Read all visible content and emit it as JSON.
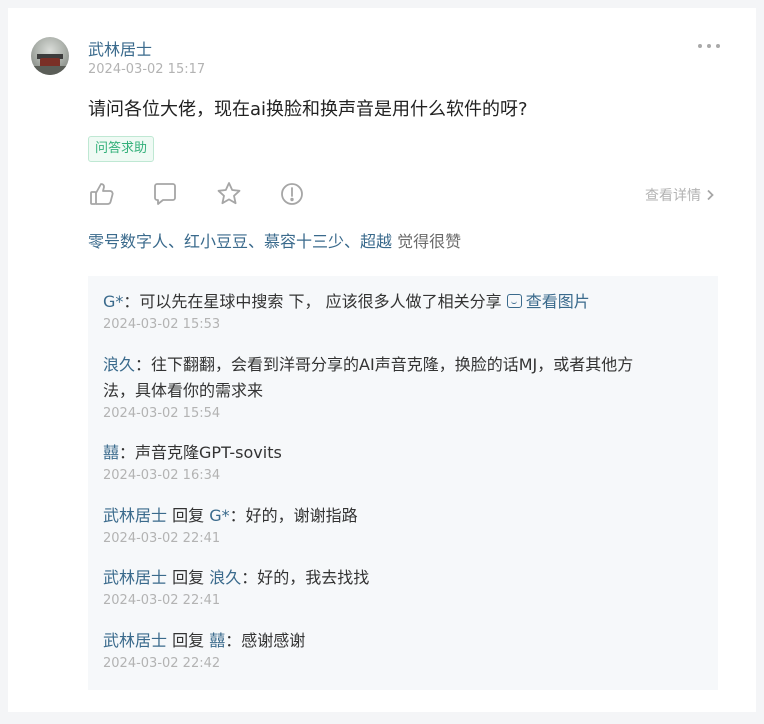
{
  "post": {
    "author": "武林居士",
    "time": "2024-03-02 15:17",
    "text": "请问各位大佬，现在ai换脸和换声音是用什么软件的呀?",
    "tag": "问答求助",
    "view_details": "查看详情",
    "likers": "零号数字人、红小豆豆、慕容十三少、超越",
    "likers_suffix": " 觉得很赞"
  },
  "icons": [
    "thumbs-up-icon",
    "comment-icon",
    "star-icon",
    "alert-icon",
    "more-icon",
    "chevron-right-icon",
    "image-icon"
  ],
  "comments": [
    {
      "name": "G*",
      "sep": "：",
      "text": "可以先在星球中搜索 下， 应该很多人做了相关分享 ",
      "link": "查看图片",
      "time": "2024-03-02 15:53"
    },
    {
      "name": "浪久",
      "sep": "：",
      "text_line1": "往下翻翻，会看到洋哥分享的AI声音克隆，换脸的话MJ，或者其他方",
      "text_line2": "法，具体看你的需求来",
      "time": "2024-03-02 15:54"
    },
    {
      "name": "囍",
      "sep": "：",
      "text": "声音克隆GPT-sovits",
      "time": "2024-03-02 16:34"
    },
    {
      "name": "武林居士",
      "reply_word": " 回复 ",
      "target": "G*",
      "sep": "：",
      "text": "好的，谢谢指路",
      "time": "2024-03-02 22:41"
    },
    {
      "name": "武林居士",
      "reply_word": " 回复 ",
      "target": "浪久",
      "sep": "：",
      "text": "好的，我去找找",
      "time": "2024-03-02 22:41"
    },
    {
      "name": "武林居士",
      "reply_word": " 回复 ",
      "target": "囍",
      "sep": "：",
      "text": "感谢感谢",
      "time": "2024-03-02 22:42"
    }
  ]
}
